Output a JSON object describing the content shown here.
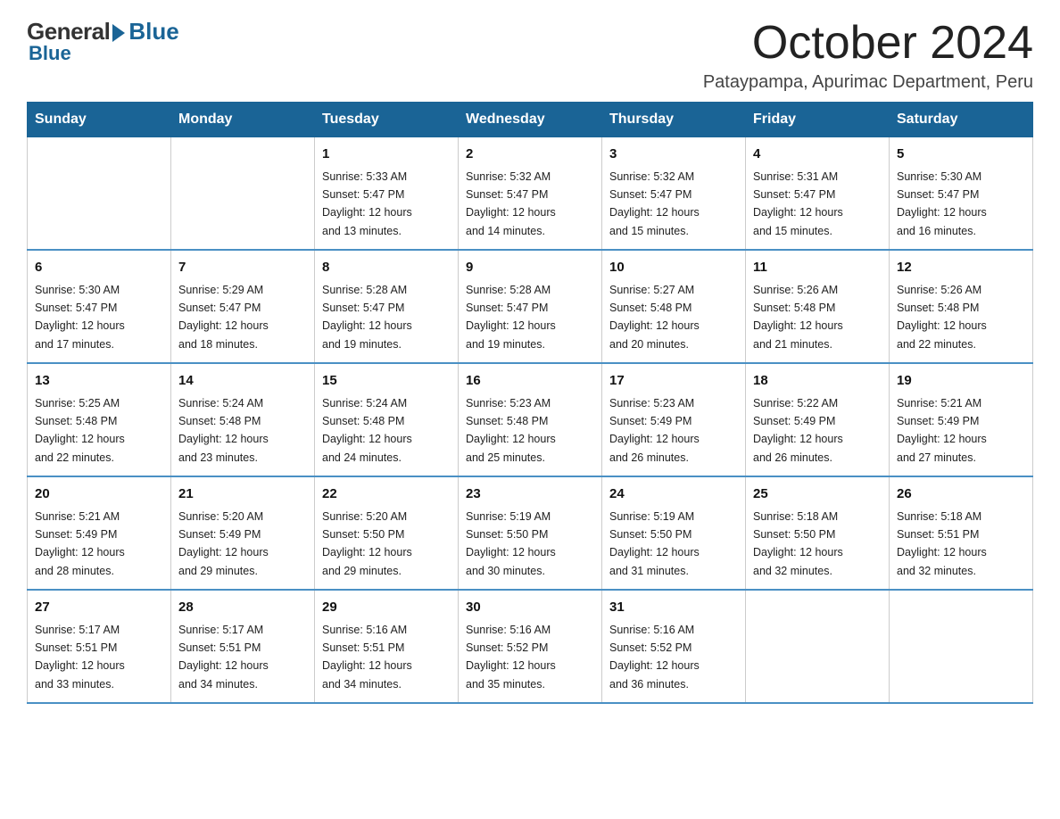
{
  "logo": {
    "general": "General",
    "blue": "Blue"
  },
  "header": {
    "month": "October 2024",
    "location": "Pataypampa, Apurimac Department, Peru"
  },
  "weekdays": [
    "Sunday",
    "Monday",
    "Tuesday",
    "Wednesday",
    "Thursday",
    "Friday",
    "Saturday"
  ],
  "weeks": [
    [
      {
        "day": "",
        "info": ""
      },
      {
        "day": "",
        "info": ""
      },
      {
        "day": "1",
        "info": "Sunrise: 5:33 AM\nSunset: 5:47 PM\nDaylight: 12 hours\nand 13 minutes."
      },
      {
        "day": "2",
        "info": "Sunrise: 5:32 AM\nSunset: 5:47 PM\nDaylight: 12 hours\nand 14 minutes."
      },
      {
        "day": "3",
        "info": "Sunrise: 5:32 AM\nSunset: 5:47 PM\nDaylight: 12 hours\nand 15 minutes."
      },
      {
        "day": "4",
        "info": "Sunrise: 5:31 AM\nSunset: 5:47 PM\nDaylight: 12 hours\nand 15 minutes."
      },
      {
        "day": "5",
        "info": "Sunrise: 5:30 AM\nSunset: 5:47 PM\nDaylight: 12 hours\nand 16 minutes."
      }
    ],
    [
      {
        "day": "6",
        "info": "Sunrise: 5:30 AM\nSunset: 5:47 PM\nDaylight: 12 hours\nand 17 minutes."
      },
      {
        "day": "7",
        "info": "Sunrise: 5:29 AM\nSunset: 5:47 PM\nDaylight: 12 hours\nand 18 minutes."
      },
      {
        "day": "8",
        "info": "Sunrise: 5:28 AM\nSunset: 5:47 PM\nDaylight: 12 hours\nand 19 minutes."
      },
      {
        "day": "9",
        "info": "Sunrise: 5:28 AM\nSunset: 5:47 PM\nDaylight: 12 hours\nand 19 minutes."
      },
      {
        "day": "10",
        "info": "Sunrise: 5:27 AM\nSunset: 5:48 PM\nDaylight: 12 hours\nand 20 minutes."
      },
      {
        "day": "11",
        "info": "Sunrise: 5:26 AM\nSunset: 5:48 PM\nDaylight: 12 hours\nand 21 minutes."
      },
      {
        "day": "12",
        "info": "Sunrise: 5:26 AM\nSunset: 5:48 PM\nDaylight: 12 hours\nand 22 minutes."
      }
    ],
    [
      {
        "day": "13",
        "info": "Sunrise: 5:25 AM\nSunset: 5:48 PM\nDaylight: 12 hours\nand 22 minutes."
      },
      {
        "day": "14",
        "info": "Sunrise: 5:24 AM\nSunset: 5:48 PM\nDaylight: 12 hours\nand 23 minutes."
      },
      {
        "day": "15",
        "info": "Sunrise: 5:24 AM\nSunset: 5:48 PM\nDaylight: 12 hours\nand 24 minutes."
      },
      {
        "day": "16",
        "info": "Sunrise: 5:23 AM\nSunset: 5:48 PM\nDaylight: 12 hours\nand 25 minutes."
      },
      {
        "day": "17",
        "info": "Sunrise: 5:23 AM\nSunset: 5:49 PM\nDaylight: 12 hours\nand 26 minutes."
      },
      {
        "day": "18",
        "info": "Sunrise: 5:22 AM\nSunset: 5:49 PM\nDaylight: 12 hours\nand 26 minutes."
      },
      {
        "day": "19",
        "info": "Sunrise: 5:21 AM\nSunset: 5:49 PM\nDaylight: 12 hours\nand 27 minutes."
      }
    ],
    [
      {
        "day": "20",
        "info": "Sunrise: 5:21 AM\nSunset: 5:49 PM\nDaylight: 12 hours\nand 28 minutes."
      },
      {
        "day": "21",
        "info": "Sunrise: 5:20 AM\nSunset: 5:49 PM\nDaylight: 12 hours\nand 29 minutes."
      },
      {
        "day": "22",
        "info": "Sunrise: 5:20 AM\nSunset: 5:50 PM\nDaylight: 12 hours\nand 29 minutes."
      },
      {
        "day": "23",
        "info": "Sunrise: 5:19 AM\nSunset: 5:50 PM\nDaylight: 12 hours\nand 30 minutes."
      },
      {
        "day": "24",
        "info": "Sunrise: 5:19 AM\nSunset: 5:50 PM\nDaylight: 12 hours\nand 31 minutes."
      },
      {
        "day": "25",
        "info": "Sunrise: 5:18 AM\nSunset: 5:50 PM\nDaylight: 12 hours\nand 32 minutes."
      },
      {
        "day": "26",
        "info": "Sunrise: 5:18 AM\nSunset: 5:51 PM\nDaylight: 12 hours\nand 32 minutes."
      }
    ],
    [
      {
        "day": "27",
        "info": "Sunrise: 5:17 AM\nSunset: 5:51 PM\nDaylight: 12 hours\nand 33 minutes."
      },
      {
        "day": "28",
        "info": "Sunrise: 5:17 AM\nSunset: 5:51 PM\nDaylight: 12 hours\nand 34 minutes."
      },
      {
        "day": "29",
        "info": "Sunrise: 5:16 AM\nSunset: 5:51 PM\nDaylight: 12 hours\nand 34 minutes."
      },
      {
        "day": "30",
        "info": "Sunrise: 5:16 AM\nSunset: 5:52 PM\nDaylight: 12 hours\nand 35 minutes."
      },
      {
        "day": "31",
        "info": "Sunrise: 5:16 AM\nSunset: 5:52 PM\nDaylight: 12 hours\nand 36 minutes."
      },
      {
        "day": "",
        "info": ""
      },
      {
        "day": "",
        "info": ""
      }
    ]
  ]
}
